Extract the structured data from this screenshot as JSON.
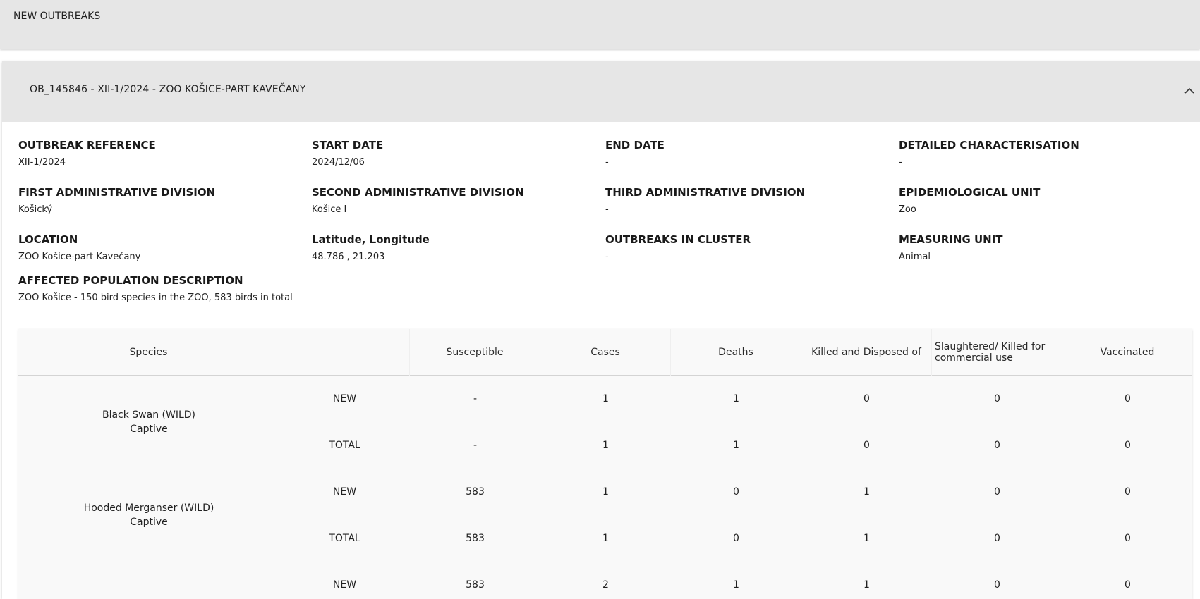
{
  "top_bar": {
    "title": "NEW OUTBREAKS"
  },
  "outbreak": {
    "header_title": "OB_145846 - XII-1/2024 - ZOO KOŠICE-PART KAVEČANY",
    "fields": {
      "outbreak_reference": {
        "label": "OUTBREAK REFERENCE",
        "value": "XII-1/2024"
      },
      "start_date": {
        "label": "START DATE",
        "value": "2024/12/06"
      },
      "end_date": {
        "label": "END DATE",
        "value": "-"
      },
      "detailed_characterisation": {
        "label": "DETAILED CHARACTERISATION",
        "value": "-"
      },
      "first_admin_division": {
        "label": "FIRST ADMINISTRATIVE DIVISION",
        "value": "Košický"
      },
      "second_admin_division": {
        "label": "SECOND ADMINISTRATIVE DIVISION",
        "value": "Košice I"
      },
      "third_admin_division": {
        "label": "THIRD ADMINISTRATIVE DIVISION",
        "value": "-"
      },
      "epidemiological_unit": {
        "label": "EPIDEMIOLOGICAL UNIT",
        "value": "Zoo"
      },
      "location": {
        "label": "LOCATION",
        "value": "ZOO Košice-part Kavečany"
      },
      "lat_long": {
        "label": "Latitude, Longitude",
        "value": "48.786 , 21.203"
      },
      "outbreaks_in_cluster": {
        "label": "OUTBREAKS IN CLUSTER",
        "value": "-"
      },
      "measuring_unit": {
        "label": "MEASURING UNIT",
        "value": "Animal"
      },
      "affected_population": {
        "label": "AFFECTED POPULATION DESCRIPTION",
        "value": "ZOO Košice - 150 bird species in the ZOO, 583 birds in total"
      }
    }
  },
  "table": {
    "headers": {
      "species": "Species",
      "type": "",
      "susceptible": "Susceptible",
      "cases": "Cases",
      "deaths": "Deaths",
      "killed": "Killed and Disposed of",
      "slaughtered": "Slaughtered/ Killed for commercial use",
      "vaccinated": "Vaccinated"
    },
    "groups": [
      {
        "species_line1": "Black Swan (WILD)",
        "species_line2": "Captive",
        "rows": [
          {
            "type": "NEW",
            "susceptible": "-",
            "cases": "1",
            "deaths": "1",
            "killed": "0",
            "slaughtered": "0",
            "vaccinated": "0"
          },
          {
            "type": "TOTAL",
            "susceptible": "-",
            "cases": "1",
            "deaths": "1",
            "killed": "0",
            "slaughtered": "0",
            "vaccinated": "0"
          }
        ]
      },
      {
        "species_line1": "Hooded Merganser (WILD)",
        "species_line2": "Captive",
        "rows": [
          {
            "type": "NEW",
            "susceptible": "583",
            "cases": "1",
            "deaths": "0",
            "killed": "1",
            "slaughtered": "0",
            "vaccinated": "0"
          },
          {
            "type": "TOTAL",
            "susceptible": "583",
            "cases": "1",
            "deaths": "0",
            "killed": "1",
            "slaughtered": "0",
            "vaccinated": "0"
          }
        ]
      },
      {
        "species_line1": "",
        "species_line2": "",
        "rows": [
          {
            "type": "NEW",
            "susceptible": "583",
            "cases": "2",
            "deaths": "1",
            "killed": "1",
            "slaughtered": "0",
            "vaccinated": "0"
          }
        ]
      }
    ]
  }
}
